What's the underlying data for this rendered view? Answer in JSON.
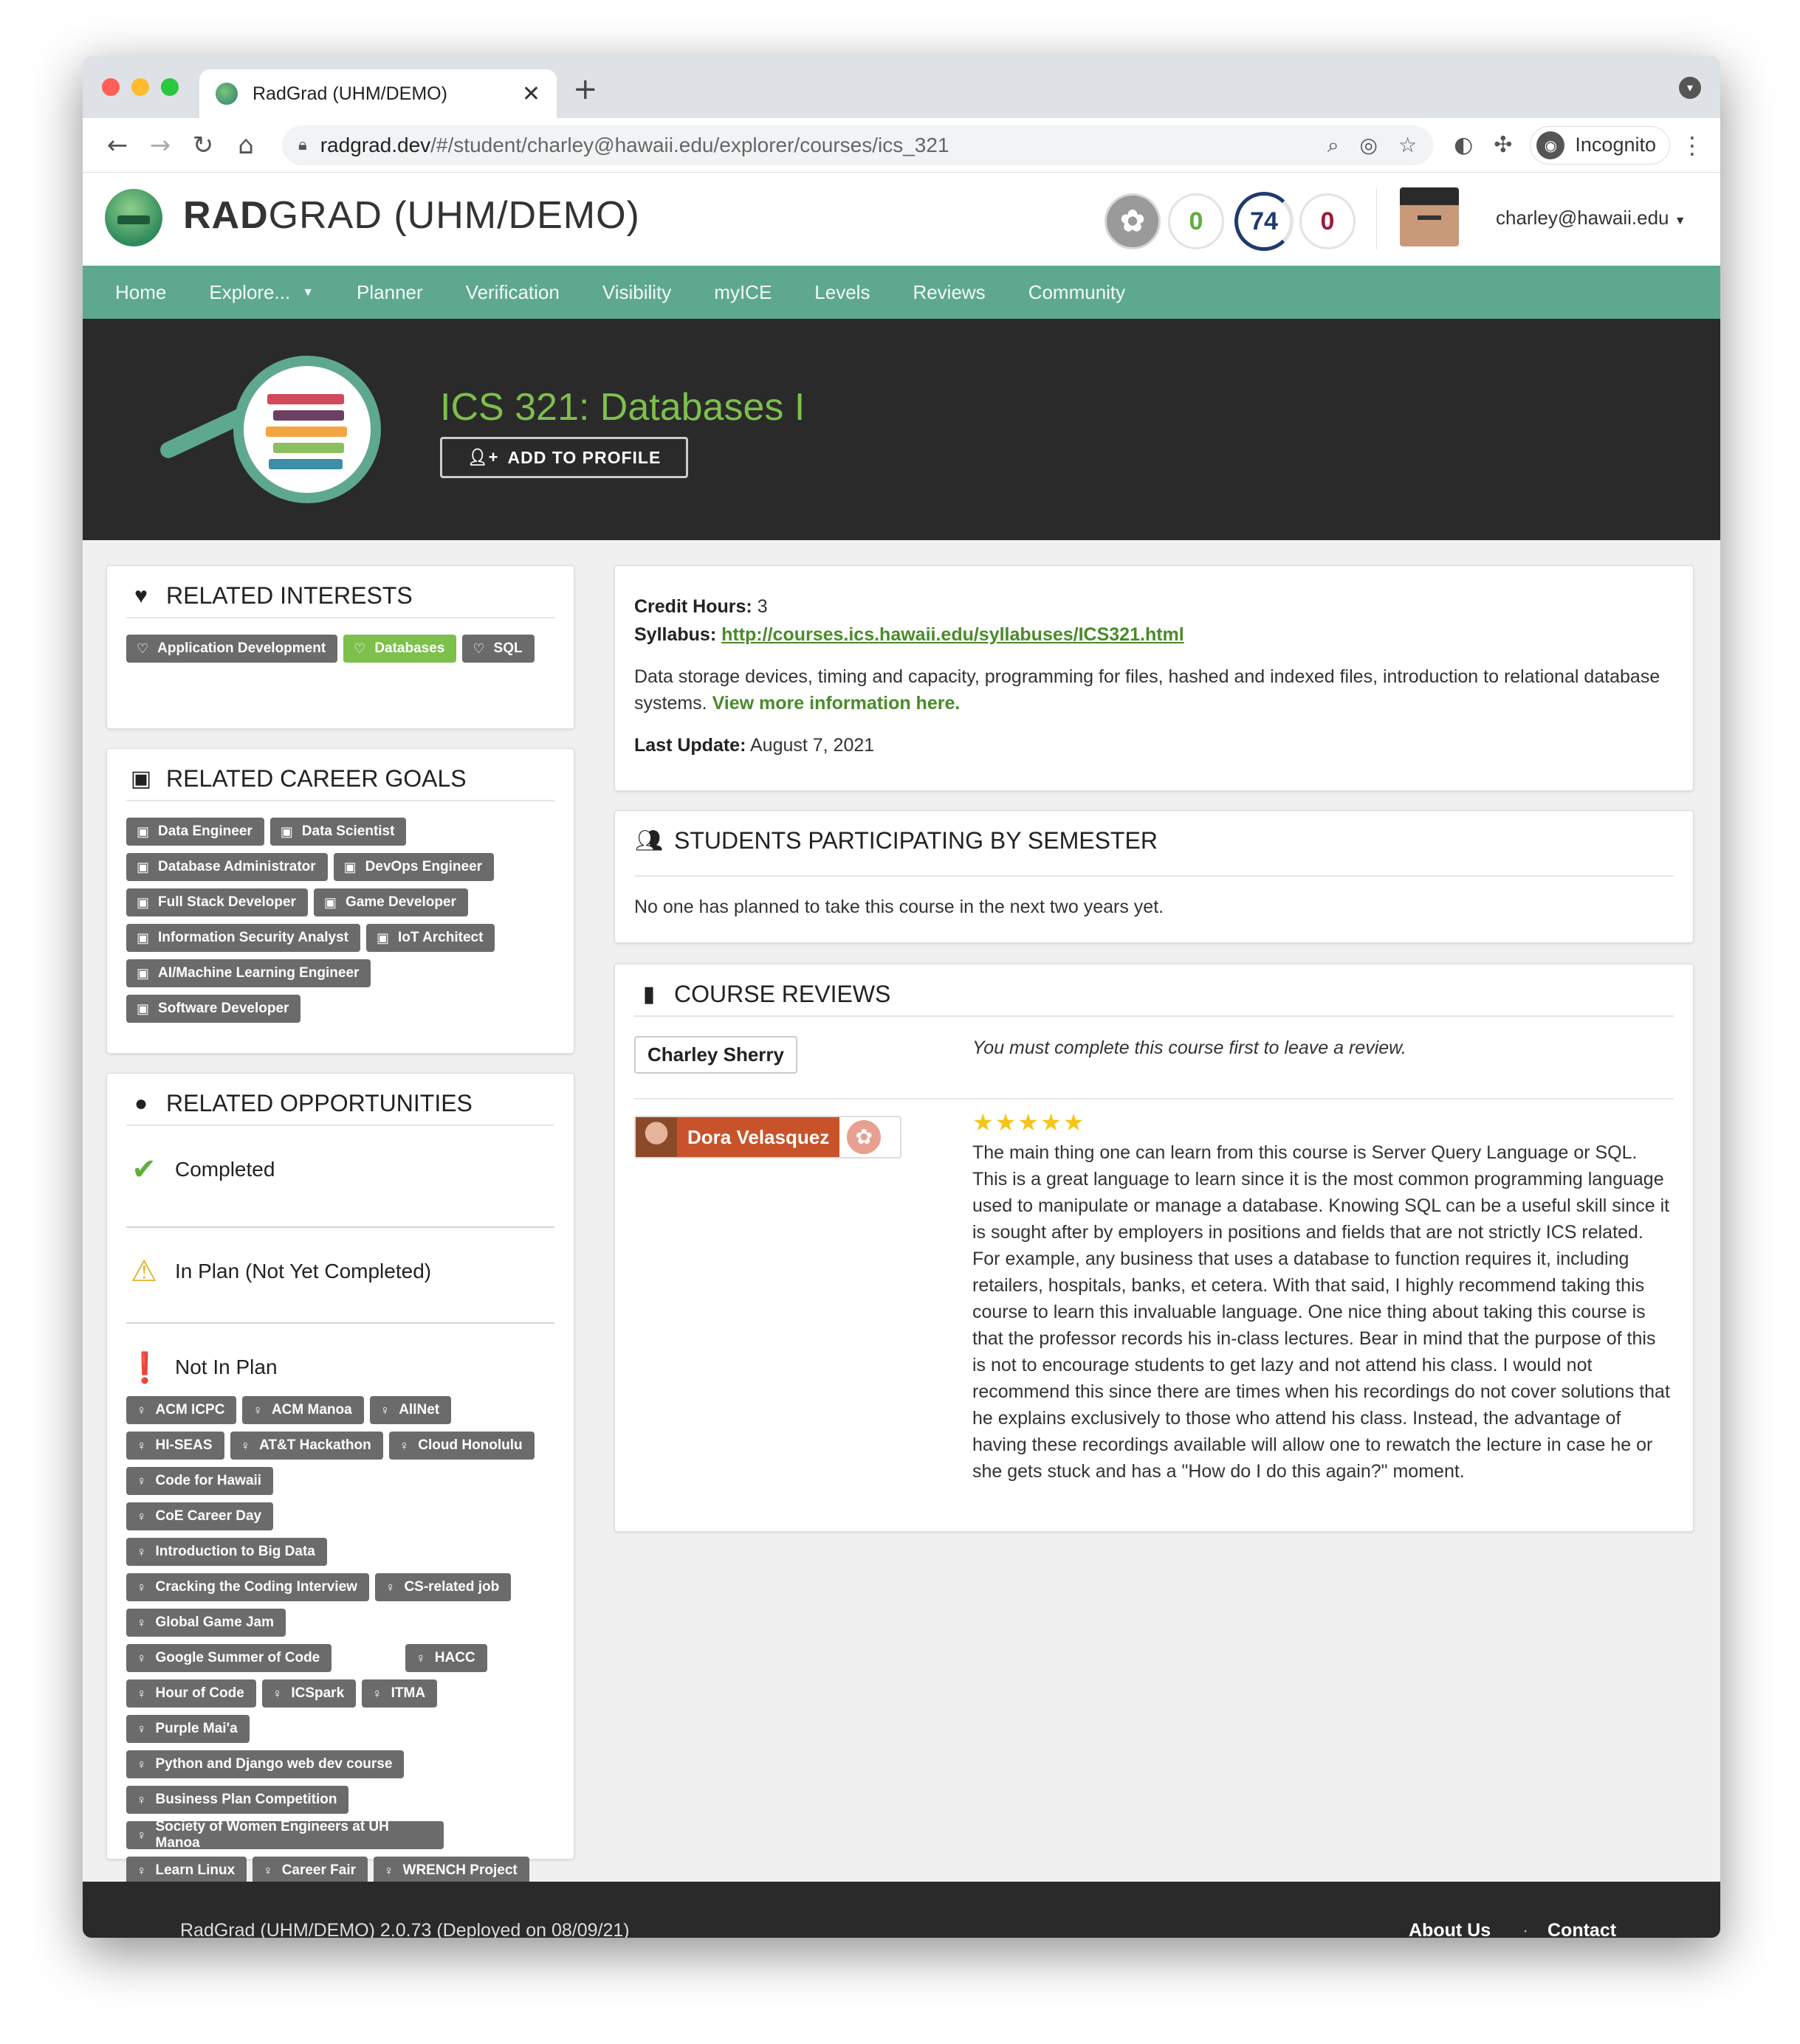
{
  "browser": {
    "tab_title": "RadGrad (UHM/DEMO)",
    "url_host": "radgrad.dev",
    "url_path": "/#/student/charley@hawaii.edu/explorer/courses/ics_321",
    "incognito_label": "Incognito"
  },
  "header": {
    "app_name_bold": "RAD",
    "app_name_rest": "GRAD (UHM/DEMO)",
    "ice": {
      "i": "0",
      "c": "74",
      "e": "0"
    },
    "user_email": "charley@hawaii.edu"
  },
  "nav": {
    "items": [
      "Home",
      "Explore...",
      "Planner",
      "Verification",
      "Visibility",
      "myICE",
      "Levels",
      "Reviews",
      "Community"
    ]
  },
  "banner": {
    "title": "ICS 321: Databases I",
    "add_button": "ADD TO PROFILE"
  },
  "interests": {
    "heading": "RELATED INTERESTS",
    "items": [
      {
        "label": "Application Development",
        "highlight": false
      },
      {
        "label": "Databases",
        "highlight": true
      },
      {
        "label": "SQL",
        "highlight": false
      }
    ]
  },
  "careers": {
    "heading": "RELATED CAREER GOALS",
    "items": [
      "Data Engineer",
      "Data Scientist",
      "Database Administrator",
      "DevOps Engineer",
      "Full Stack Developer",
      "Game Developer",
      "Information Security Analyst",
      "IoT Architect",
      "AI/Machine Learning Engineer",
      "Software Developer"
    ]
  },
  "opportunities": {
    "heading": "RELATED OPPORTUNITIES",
    "completed": "Completed",
    "in_plan": "In Plan (Not Yet Completed)",
    "not_in_plan": "Not In Plan",
    "items": [
      "ACM ICPC",
      "ACM Manoa",
      "AllNet",
      "HI-SEAS",
      "AT&T Hackathon",
      "Cloud Honolulu",
      "Code for Hawaii",
      "CoE Career Day",
      "Introduction to Big Data",
      "Cracking the Coding Interview",
      "CS-related job",
      "Global Game Jam",
      "Google Summer of Code",
      "HACC",
      "Hour of Code",
      "ICSpark",
      "ITMA",
      "Purple Mai'a",
      "Python and Django web dev course",
      "Business Plan Competition",
      "Society of Women Engineers at UH Manoa",
      "Learn Linux",
      "Career Fair",
      "WRENCH Project"
    ]
  },
  "course_info": {
    "credit_label": "Credit Hours:",
    "credit_value": "3",
    "syllabus_label": "Syllabus:",
    "syllabus_url": "http://courses.ics.hawaii.edu/syllabuses/ICS321.html",
    "description": "Data storage devices, timing and capacity, programming for files, hashed and indexed files, introduction to relational database systems.",
    "more_link": "View more information here.",
    "last_update_label": "Last Update:",
    "last_update_value": "August 7, 2021"
  },
  "students": {
    "heading": "STUDENTS PARTICIPATING BY SEMESTER",
    "message": "No one has planned to take this course in the next two years yet."
  },
  "reviews": {
    "heading": "COURSE REVIEWS",
    "current_user": "Charley Sherry",
    "current_note": "You must complete this course first to leave a review.",
    "reviewer": "Dora Velasquez",
    "rating": 5,
    "stars": "★★★★★",
    "text": "The main thing one can learn from this course is Server Query Language or SQL. This is a great language to learn since it is the most common programming language used to manipulate or manage a database. Knowing SQL can be a useful skill since it is sought after by employers in positions and fields that are not strictly ICS related. For example, any business that uses a database to function requires it, including retailers, hospitals, banks, et cetera. With that said, I highly recommend taking this course to learn this invaluable language. One nice thing about taking this course is that the professor records his in-class lectures. Bear in mind that the purpose of this is not to encourage students to get lazy and not attend his class. I would not recommend this since there are times when his recordings do not cover solutions that he explains exclusively to those who attend his class. Instead, the advantage of having these recordings available will allow one to rewatch the lecture in case he or she gets stuck and has a \"How do I do this again?\" moment."
  },
  "footer": {
    "version": "RadGrad (UHM/DEMO) 2.0.73 (Deployed on 08/09/21)",
    "about": "About Us",
    "contact": "Contact"
  },
  "colors": {
    "nav_bg": "#5fa890",
    "title_green": "#7dc04c",
    "label_gray": "#6b6b6b",
    "banner_bg": "#2a2a2a"
  }
}
